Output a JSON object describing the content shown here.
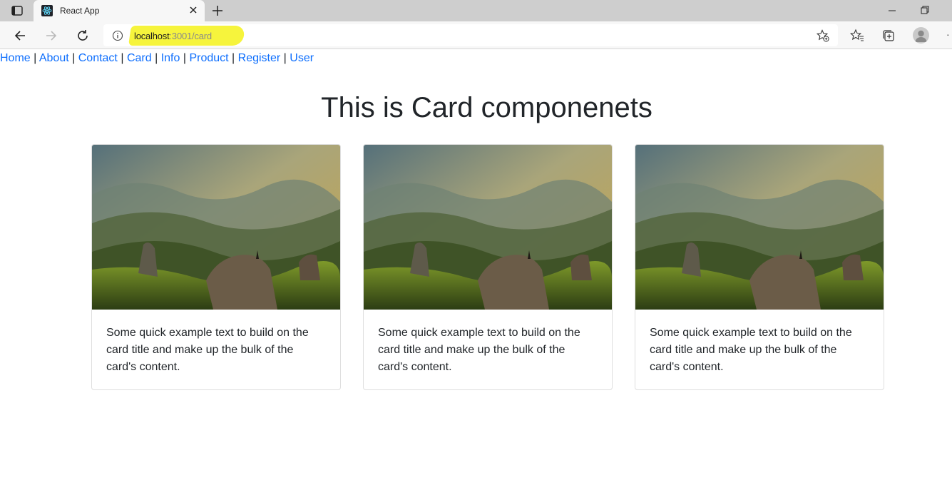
{
  "browser": {
    "tab_title": "React App",
    "url_host": "localhost",
    "url_rest": ":3001/card"
  },
  "nav": {
    "links": [
      "Home",
      "About",
      "Contact",
      "Card",
      "Info",
      "Product",
      "Register",
      "User"
    ],
    "separator": "|"
  },
  "page": {
    "title": "This is Card componenets"
  },
  "cards": [
    {
      "text": "Some quick example text to build on the card title and make up the bulk of the card's content."
    },
    {
      "text": "Some quick example text to build on the card title and make up the bulk of the card's content."
    },
    {
      "text": "Some quick example text to build on the card title and make up the bulk of the card's content."
    }
  ],
  "icons": {
    "tab_actions": "tab-actions-icon",
    "favicon": "react-icon",
    "tab_close": "close-icon",
    "new_tab": "plus-icon",
    "back": "back-arrow-icon",
    "forward": "forward-arrow-icon",
    "reload": "reload-icon",
    "site_info": "info-icon",
    "add_favorite": "star-plus-icon",
    "favorites": "favorites-icon",
    "collections": "collections-icon",
    "profile": "profile-icon",
    "minimize": "minimize-icon",
    "restore": "restore-icon"
  },
  "colors": {
    "link": "#0d6efd",
    "text": "#212529",
    "url_highlight": "#f6f43c"
  }
}
